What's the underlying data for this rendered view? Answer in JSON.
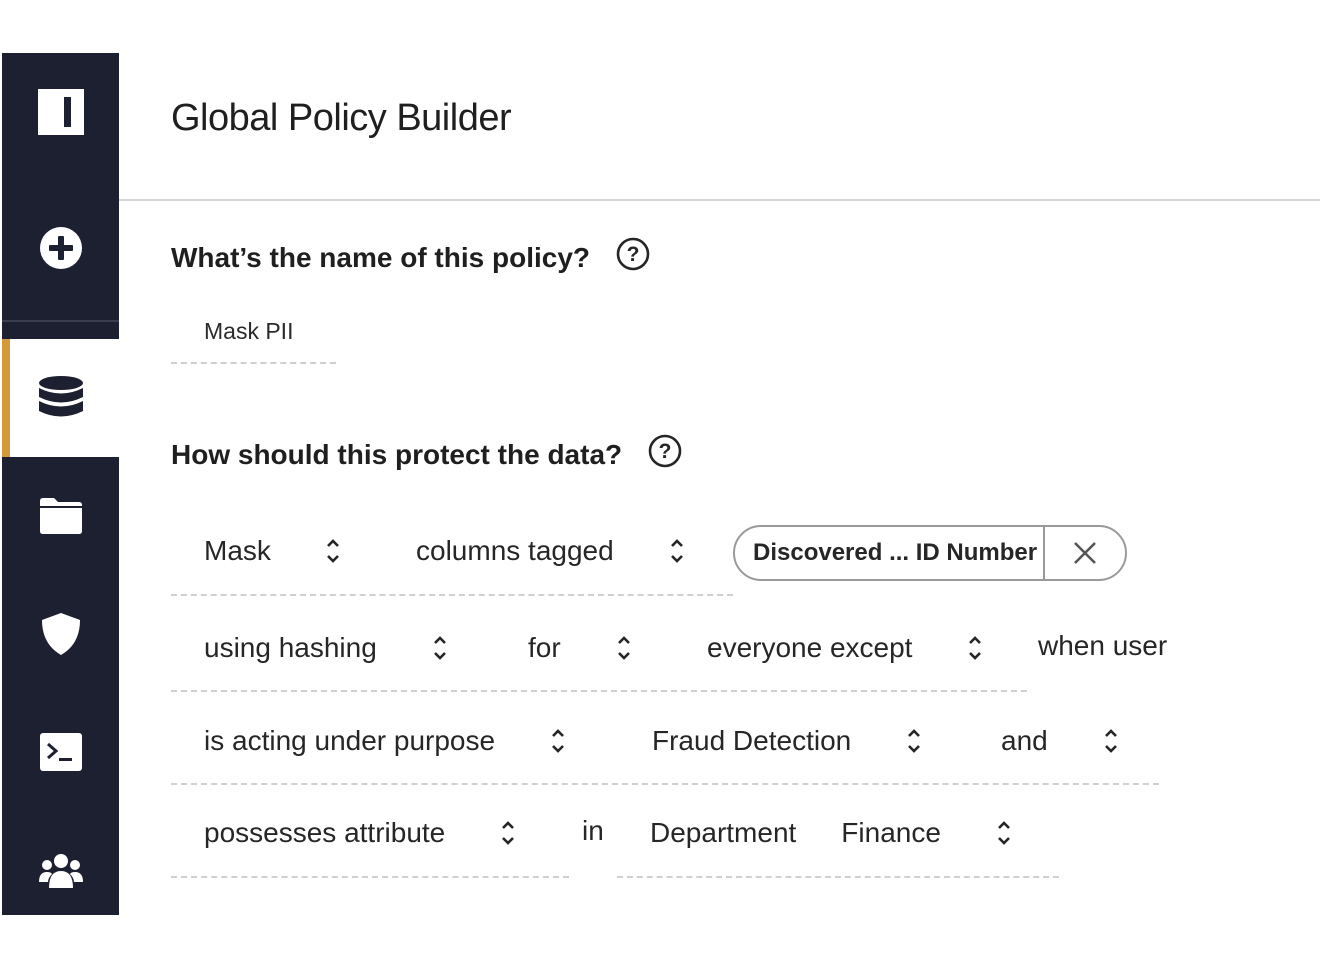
{
  "page": {
    "title": "Global Policy Builder"
  },
  "sidebar": {
    "items": [
      {
        "name": "logo",
        "icon": "logo-icon"
      },
      {
        "name": "add",
        "icon": "plus-circle-icon"
      },
      {
        "name": "data-sources",
        "icon": "database-icon",
        "active": true
      },
      {
        "name": "projects",
        "icon": "folder-icon"
      },
      {
        "name": "policies",
        "icon": "shield-icon"
      },
      {
        "name": "query-editor",
        "icon": "terminal-icon"
      },
      {
        "name": "people",
        "icon": "users-icon"
      }
    ],
    "bg_color": "#1d2030",
    "active_accent": "#d39a3b"
  },
  "policy_name": {
    "question": "What’s the name of this policy?",
    "value": "Mask PII"
  },
  "protection": {
    "question": "How should this protect the data?",
    "rows": {
      "row1": {
        "action": "Mask",
        "target": "columns tagged",
        "tag_chip": "Discovered ... ID Number"
      },
      "row2": {
        "method": "using hashing",
        "for": "for",
        "scope": "everyone except",
        "condition_text": "when user"
      },
      "row3": {
        "condition": "is acting under purpose",
        "purpose": "Fraud Detection",
        "conjunction": "and"
      },
      "row4": {
        "condition": "possesses attribute",
        "in_text": "in",
        "attribute_key": "Department",
        "attribute_value": "Finance"
      }
    }
  }
}
